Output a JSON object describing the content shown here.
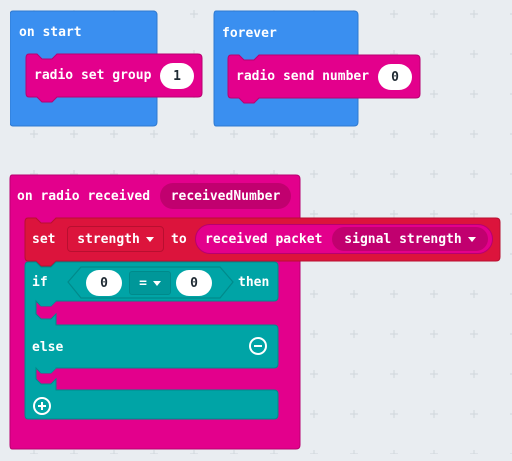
{
  "colors": {
    "basic": "#3a8ff0",
    "radio": "#e3008c",
    "radio_dark": "#c1006f",
    "variable": "#dc143c",
    "logic": "#00a4a6",
    "logic_dark": "#008a8b",
    "workspace": "#e9edf1"
  },
  "on_start": {
    "label": "on start",
    "set_group": {
      "label": "radio set group",
      "value": "1"
    }
  },
  "forever": {
    "label": "forever",
    "send_number": {
      "label": "radio send number",
      "value": "0"
    }
  },
  "on_radio_received": {
    "label": "on radio received",
    "param": "receivedNumber",
    "set_stmt": {
      "set_label": "set",
      "variable": "strength",
      "to_label": "to",
      "received_packet_label": "received packet",
      "packet_property": "signal strength"
    },
    "if_block": {
      "if_label": "if",
      "left_value": "0",
      "operator": "=",
      "right_value": "0",
      "then_label": "then",
      "else_label": "else"
    }
  }
}
